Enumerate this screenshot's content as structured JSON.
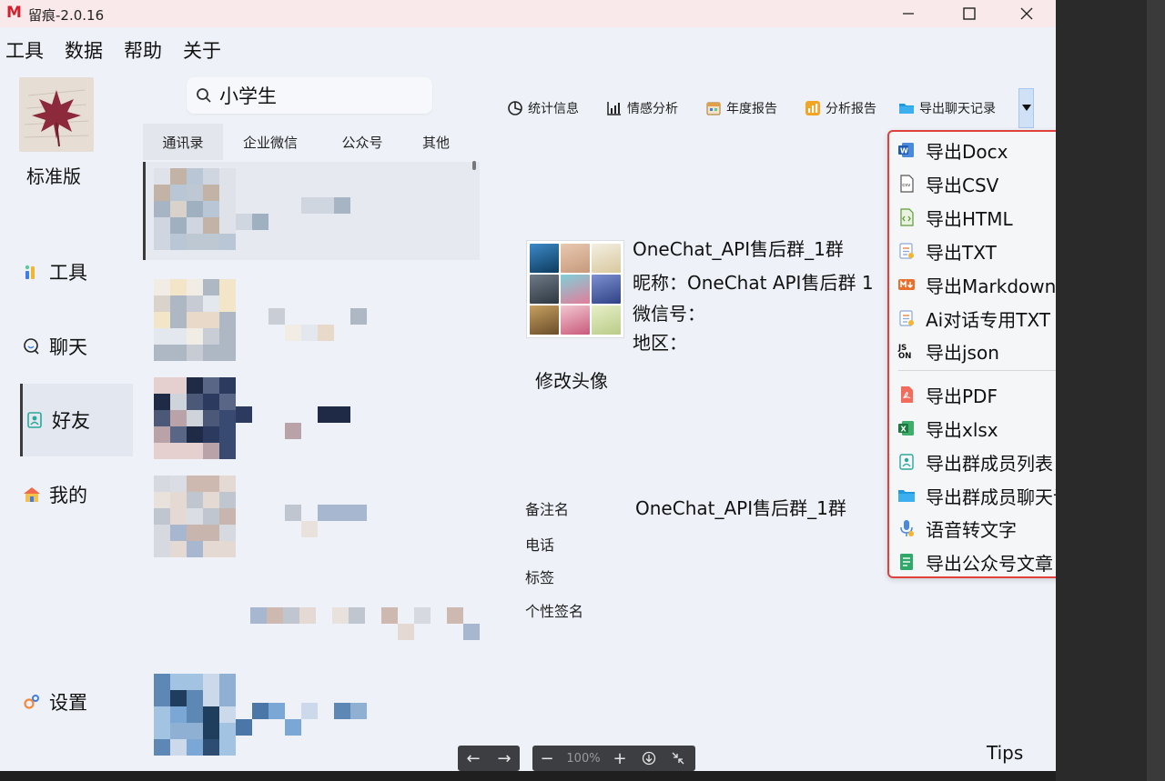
{
  "window": {
    "title": "留痕-2.0.16",
    "logo": "M",
    "controls": [
      "minimize-icon",
      "maximize-icon",
      "close-icon"
    ]
  },
  "menu": [
    "工具",
    "数据",
    "帮助",
    "关于"
  ],
  "sidebar": {
    "edition": "标准版",
    "items": [
      {
        "label": "工具",
        "icon": "tools-icon",
        "active": false
      },
      {
        "label": "聊天",
        "icon": "chat-icon",
        "active": false
      },
      {
        "label": "好友",
        "icon": "contact-icon",
        "active": true
      },
      {
        "label": "我的",
        "icon": "home-icon",
        "active": false
      },
      {
        "label": "设置",
        "icon": "settings-icon",
        "active": false
      }
    ]
  },
  "search": {
    "value": "小学生",
    "icon": "search-icon"
  },
  "tabs": [
    "通讯录",
    "企业微信",
    "公众号",
    "其他"
  ],
  "toolbar": [
    {
      "label": "统计信息",
      "icon": "pie-chart-icon"
    },
    {
      "label": "情感分析",
      "icon": "bar-chart-icon"
    },
    {
      "label": "年度报告",
      "icon": "calendar-report-icon"
    },
    {
      "label": "分析报告",
      "icon": "analysis-report-icon"
    },
    {
      "label": "导出聊天记录",
      "icon": "folder-export-icon"
    }
  ],
  "contact": {
    "name": "OneChat_API售后群_1群",
    "nickname": "昵称：OneChat API售后群 1",
    "wechat_id": "微信号：",
    "region": "地区：",
    "change_avatar": "修改头像"
  },
  "details": {
    "remark_label": "备注名",
    "remark_value": "OneChat_API售后群_1群",
    "phone_label": "电话",
    "tag_label": "标签",
    "signature_label": "个性签名"
  },
  "export_menu": {
    "group1": [
      {
        "label": "导出Docx",
        "icon": "word-icon"
      },
      {
        "label": "导出CSV",
        "icon": "csv-icon"
      },
      {
        "label": "导出HTML",
        "icon": "html-icon"
      },
      {
        "label": "导出TXT",
        "icon": "txt-icon"
      },
      {
        "label": "导出Markdown",
        "icon": "markdown-icon"
      },
      {
        "label": "Ai对话专用TXT",
        "icon": "ai-txt-icon"
      },
      {
        "label": "导出json",
        "icon": "json-icon"
      }
    ],
    "group2": [
      {
        "label": "导出PDF",
        "icon": "pdf-icon"
      },
      {
        "label": "导出xlsx",
        "icon": "excel-icon"
      },
      {
        "label": "导出群成员列表",
        "icon": "member-list-icon"
      },
      {
        "label": "导出群成员聊天记录",
        "icon": "folder-export-icon"
      },
      {
        "label": "语音转文字",
        "icon": "voice-icon"
      },
      {
        "label": "导出公众号文章",
        "icon": "article-icon",
        "submenu": true
      }
    ]
  },
  "bottombar": {
    "back": "←",
    "forward": "→",
    "zoom_out": "−",
    "zoom": "100%",
    "zoom_in": "+"
  },
  "tips": "Tips",
  "colors": {
    "highlight_border": "#e0413a",
    "title_bar": "#fae9ea",
    "window_bg": "#eef2f8"
  }
}
